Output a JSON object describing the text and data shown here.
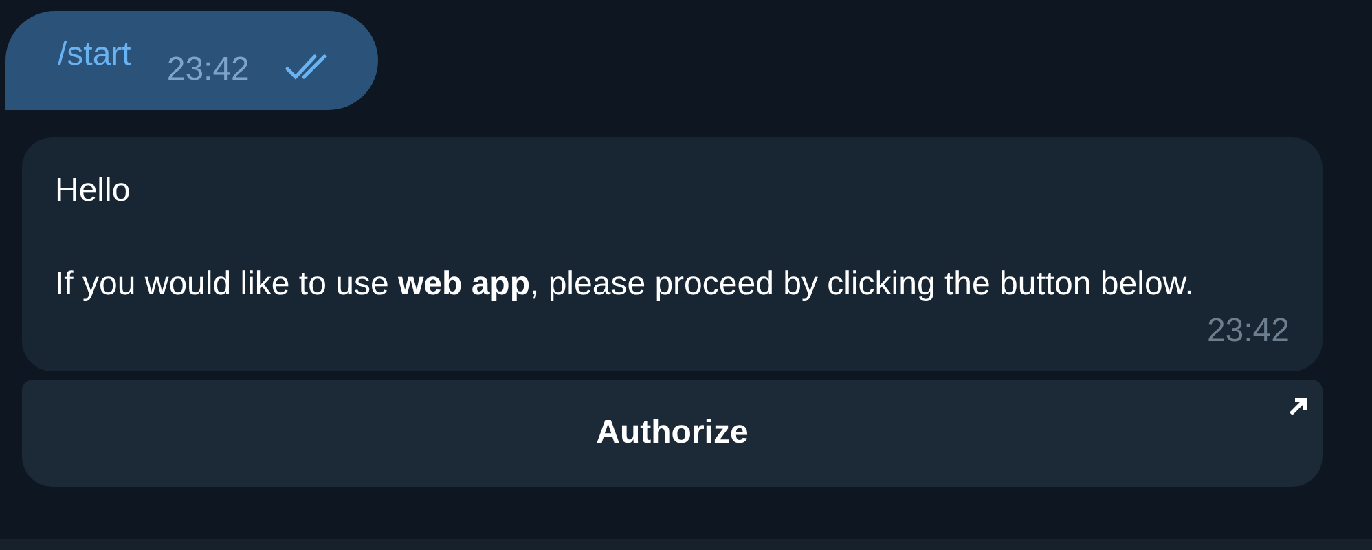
{
  "outgoing_message": {
    "text": "/start",
    "time": "23:42",
    "read": true
  },
  "incoming_message": {
    "paragraphs": [
      "Hello",
      "If you would like to use **web app**, please proceed by clicking the button below."
    ],
    "time": "23:42"
  },
  "inline_button": {
    "label": "Authorize"
  }
}
